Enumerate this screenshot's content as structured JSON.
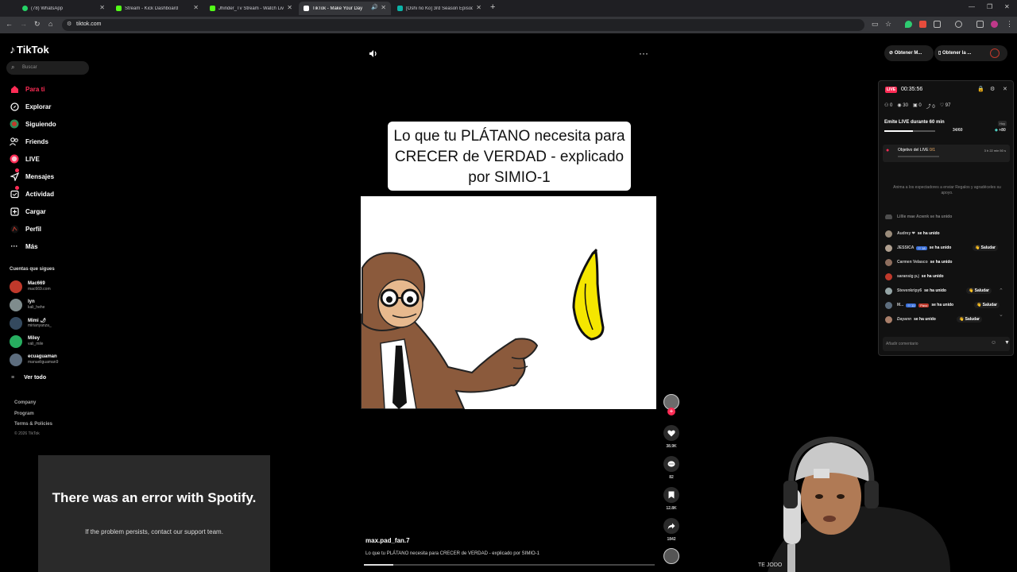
{
  "browser": {
    "tabs": [
      {
        "title": "(78) WhatsApp",
        "active": false,
        "favicon_color": "#25d366"
      },
      {
        "title": "Stream - Kick Dashboard",
        "active": false,
        "favicon_color": "#53fc18"
      },
      {
        "title": "Jhinder_Tv Stream - Watch Live",
        "active": false,
        "favicon_color": "#53fc18"
      },
      {
        "title": "TikTok - Make Your Day",
        "active": true,
        "favicon_color": "#ffffff"
      },
      {
        "title": "[Oshi no Ko] 3rd Season Episodio",
        "active": false,
        "favicon_color": "#0bb3a8"
      }
    ],
    "url": "tiktok.com"
  },
  "tiktok": {
    "logo": "TikTok",
    "search_placeholder": "Buscar",
    "nav": [
      {
        "label": "Para ti",
        "icon": "home-icon",
        "active": true
      },
      {
        "label": "Explorar",
        "icon": "compass-icon",
        "active": false
      },
      {
        "label": "Siguiendo",
        "icon": "following-icon",
        "active": false
      },
      {
        "label": "Friends",
        "icon": "friends-icon",
        "active": false
      },
      {
        "label": "LIVE",
        "icon": "live-icon",
        "active": false
      },
      {
        "label": "Mensajes",
        "icon": "messages-icon",
        "active": false
      },
      {
        "label": "Actividad",
        "icon": "activity-icon",
        "active": false
      },
      {
        "label": "Cargar",
        "icon": "upload-icon",
        "active": false
      },
      {
        "label": "Perfil",
        "icon": "profile-icon",
        "active": false
      },
      {
        "label": "Más",
        "icon": "more-icon",
        "active": false
      }
    ],
    "following_title": "Cuentas que sigues",
    "following": [
      {
        "name": "Mac669",
        "handle": "mac669.com"
      },
      {
        "name": "lyn",
        "handle": "kali_hehe"
      },
      {
        "name": "Mimi 🌶",
        "handle": "mirianyanza_"
      },
      {
        "name": "Miley",
        "handle": "vali_mile"
      },
      {
        "name": "ecuaguaman",
        "handle": "manueliguaman9"
      }
    ],
    "see_all": "Ver todo",
    "footer_links": [
      "Company",
      "Program",
      "Terms & Policies"
    ],
    "copyright": "© 2026 TikTok"
  },
  "spotify_error": {
    "title": "There was an error with Spotify.",
    "subtitle": "If the problem persists, contact our support team."
  },
  "video": {
    "caption": "Lo que tu PLÁTANO necesita para CRECER de VERDAD - explicado por SIMIO-1",
    "author": "max.pad_fan.7",
    "description": "Lo que tu PLÁTANO necesita para CRECER de VERDAD - explicado por SIMIO-1",
    "progress": 0.1,
    "actions": [
      {
        "icon": "heart-icon",
        "count": "38.9K"
      },
      {
        "icon": "comment-icon",
        "count": "82"
      },
      {
        "icon": "bookmark-icon",
        "count": "12.8K"
      },
      {
        "icon": "share-icon",
        "count": "1842"
      }
    ]
  },
  "top_buttons": {
    "obtain_1": "Obtener M...",
    "obtain_2": "Obtener la ..."
  },
  "live_panel": {
    "tag": "LIVE",
    "timer": "00:35:56",
    "stats": [
      "0",
      "30",
      "0",
      "0",
      "97"
    ],
    "goal_title": "Emite LIVE durante 60 min",
    "goal_count": "34/60",
    "goal_progress": 0.5667,
    "goal_chip": "Hoy",
    "goal_plus": "+80",
    "objective_label": "Objetivo del LIVE ",
    "objective_count": "0/1",
    "objective_time": "3 h 22 min 50 s",
    "encourage": "Anima a los espectadores a enviar Regalos y agradéceles su apoyo.",
    "chat": [
      {
        "name": "Audrey ❤",
        "text": "se ha unido",
        "greet": ""
      },
      {
        "name": "JESSICA",
        "tag": "18",
        "text": "se ha unido",
        "greet": "Saludar"
      },
      {
        "name": "Carmen Velasco",
        "text": "se ha unido",
        "greet": ""
      },
      {
        "name": "saransig p.j",
        "text": "se ha unido",
        "greet": ""
      },
      {
        "name": "Stevenkripy6",
        "text": "se ha unido",
        "greet": "Saludar"
      },
      {
        "name": "M...",
        "tag": "11",
        "tag2": "Pavo",
        "text": "se ha unido",
        "greet": "Saludar"
      },
      {
        "name": "Dayann",
        "text": "se ha unido",
        "greet": "Saludar"
      }
    ],
    "chat_partial": "Lillie mae Acwnk se ha unido",
    "comment_placeholder": "Añadir comentario"
  },
  "webcam": {
    "label": "TE JODO"
  }
}
